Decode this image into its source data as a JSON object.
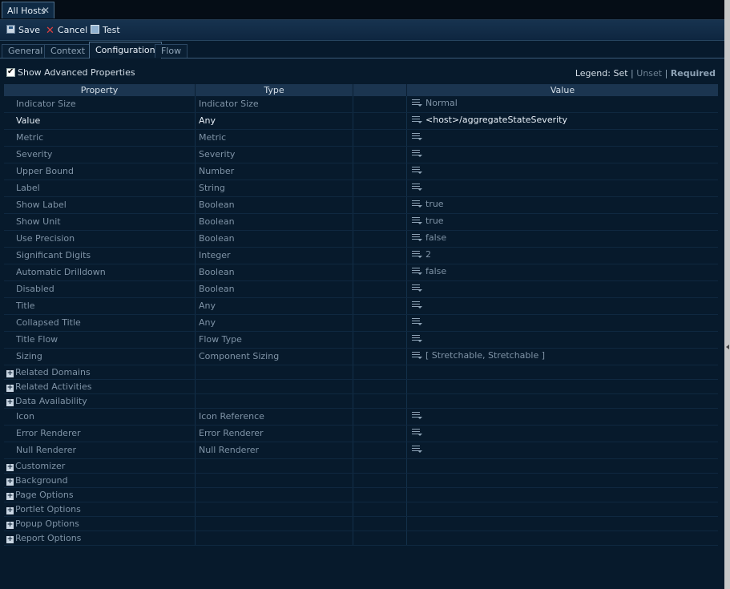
{
  "document_tab": {
    "label": "All Hosts",
    "close_glyph": "✕"
  },
  "toolbar": {
    "save_label": "Save",
    "cancel_label": "Cancel",
    "test_label": "Test"
  },
  "tabs": [
    {
      "label": "General"
    },
    {
      "label": "Context"
    },
    {
      "label": "Configuration",
      "active": true
    },
    {
      "label": "Flow"
    }
  ],
  "advanced": {
    "label": "Show Advanced Properties",
    "checked": true
  },
  "legend": {
    "prefix": "Legend:",
    "set": "Set",
    "unset": "Unset",
    "required": "Required",
    "sep": "|"
  },
  "columns": {
    "property": "Property",
    "type": "Type",
    "value": "Value"
  },
  "rows": [
    {
      "property": "Indicator Size",
      "type": "Indicator Size",
      "value": "Normal"
    },
    {
      "property": "Value",
      "type": "Any",
      "value": "<host>/aggregateStateSeverity",
      "set": true
    },
    {
      "property": "Metric",
      "type": "Metric",
      "value": ""
    },
    {
      "property": "Severity",
      "type": "Severity",
      "value": ""
    },
    {
      "property": "Upper Bound",
      "type": "Number",
      "value": ""
    },
    {
      "property": "Label",
      "type": "String",
      "value": ""
    },
    {
      "property": "Show Label",
      "type": "Boolean",
      "value": "true"
    },
    {
      "property": "Show Unit",
      "type": "Boolean",
      "value": "true"
    },
    {
      "property": "Use Precision",
      "type": "Boolean",
      "value": "false"
    },
    {
      "property": "Significant Digits",
      "type": "Integer",
      "value": "2"
    },
    {
      "property": "Automatic Drilldown",
      "type": "Boolean",
      "value": "false"
    },
    {
      "property": "Disabled",
      "type": "Boolean",
      "value": ""
    },
    {
      "property": "Title",
      "type": "Any",
      "value": ""
    },
    {
      "property": "Collapsed Title",
      "type": "Any",
      "value": ""
    },
    {
      "property": "Title Flow",
      "type": "Flow Type",
      "value": ""
    },
    {
      "property": "Sizing",
      "type": "Component Sizing",
      "value": "[ Stretchable, Stretchable ]"
    }
  ],
  "groups_a": [
    "Related Domains",
    "Related Activities",
    "Data Availability"
  ],
  "rows_b": [
    {
      "property": "Icon",
      "type": "Icon Reference",
      "value": ""
    },
    {
      "property": "Error Renderer",
      "type": "Error Renderer",
      "value": ""
    },
    {
      "property": "Null Renderer",
      "type": "Null Renderer",
      "value": ""
    }
  ],
  "groups_b": [
    "Customizer",
    "Background",
    "Page Options",
    "Portlet Options",
    "Popup Options",
    "Report Options"
  ],
  "colors": {
    "background": "#071a2c",
    "header": "#1b3550",
    "set_text": "#e6eef6",
    "unset_text": "#7f93a6"
  }
}
